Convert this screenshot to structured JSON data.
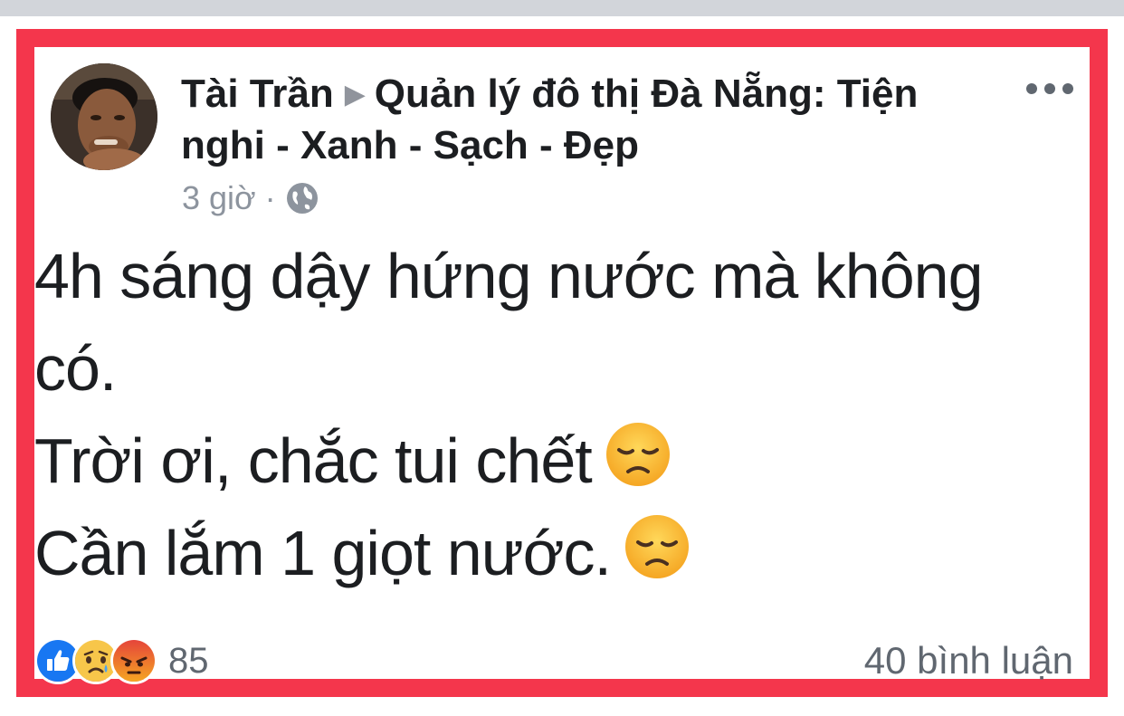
{
  "post": {
    "author": "Tài Trần",
    "group": "Quản lý đô thị Đà Nẵng: Tiện nghi - Xanh - Sạch - Đẹp",
    "time": "3 giờ",
    "separator": "·",
    "privacy_icon": "globe-icon",
    "menu_icon": "more-options-icon",
    "body_lines": [
      "4h sáng dậy hứng nước mà không",
      "có.",
      "Trời ơi, chắc tui chết",
      "Cần lắm 1 giọt nước."
    ],
    "body_emoji": "disappointed-face-emoji",
    "reactions": [
      "like",
      "sad",
      "angry"
    ],
    "reaction_count": "85",
    "comments_label": "40 bình luận"
  },
  "colors": {
    "frame_border": "#f4364c",
    "text": "#1c1e21",
    "muted": "#606770",
    "like_blue": "#1877f2"
  }
}
